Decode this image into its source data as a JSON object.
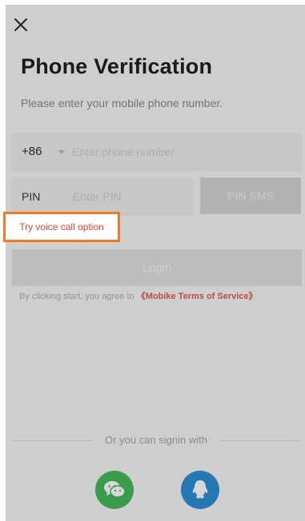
{
  "header": {
    "close_icon": "close-icon",
    "title": "Phone Verification",
    "subtitle": "Please enter your mobile phone number."
  },
  "phone": {
    "country_code": "+86",
    "placeholder": "Enter phone number"
  },
  "pin": {
    "label": "PIN",
    "placeholder": "Enter PIN",
    "sms_button": "PIN SMS"
  },
  "voice_call": {
    "label": "Try voice call option",
    "highlight_color": "#ee7b2a"
  },
  "login": {
    "label": "Login"
  },
  "terms": {
    "prefix": "By clicking start, you agree to ",
    "link": "《Mobike Terms of Service》"
  },
  "signin": {
    "text": "Or you can signin with",
    "options": [
      {
        "name": "wechat-icon",
        "color": "#47b95b"
      },
      {
        "name": "qq-icon",
        "color": "#2d8fd6"
      }
    ]
  }
}
